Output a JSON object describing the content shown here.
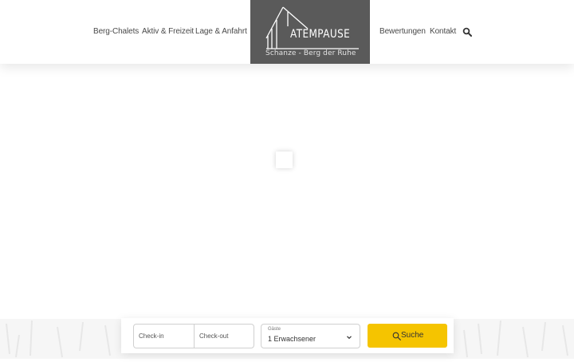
{
  "nav": {
    "left": [
      "Berg-Chalets",
      "Aktiv & Freizeit",
      "Lage & Anfahrt"
    ],
    "right": [
      "Bewertungen",
      "Kontakt"
    ]
  },
  "logo": {
    "wordmark": "ATEMPAUSE",
    "tagline": "Schanze - Berg der Ruhe"
  },
  "booking": {
    "checkin_placeholder": "Check-in",
    "checkout_placeholder": "Check-out",
    "guests_label": "Gäste",
    "guests_value": "1 Erwachsener",
    "search_label": "Suche"
  },
  "colors": {
    "accent": "#f5c400",
    "logo_bg": "#5a5a5a"
  }
}
